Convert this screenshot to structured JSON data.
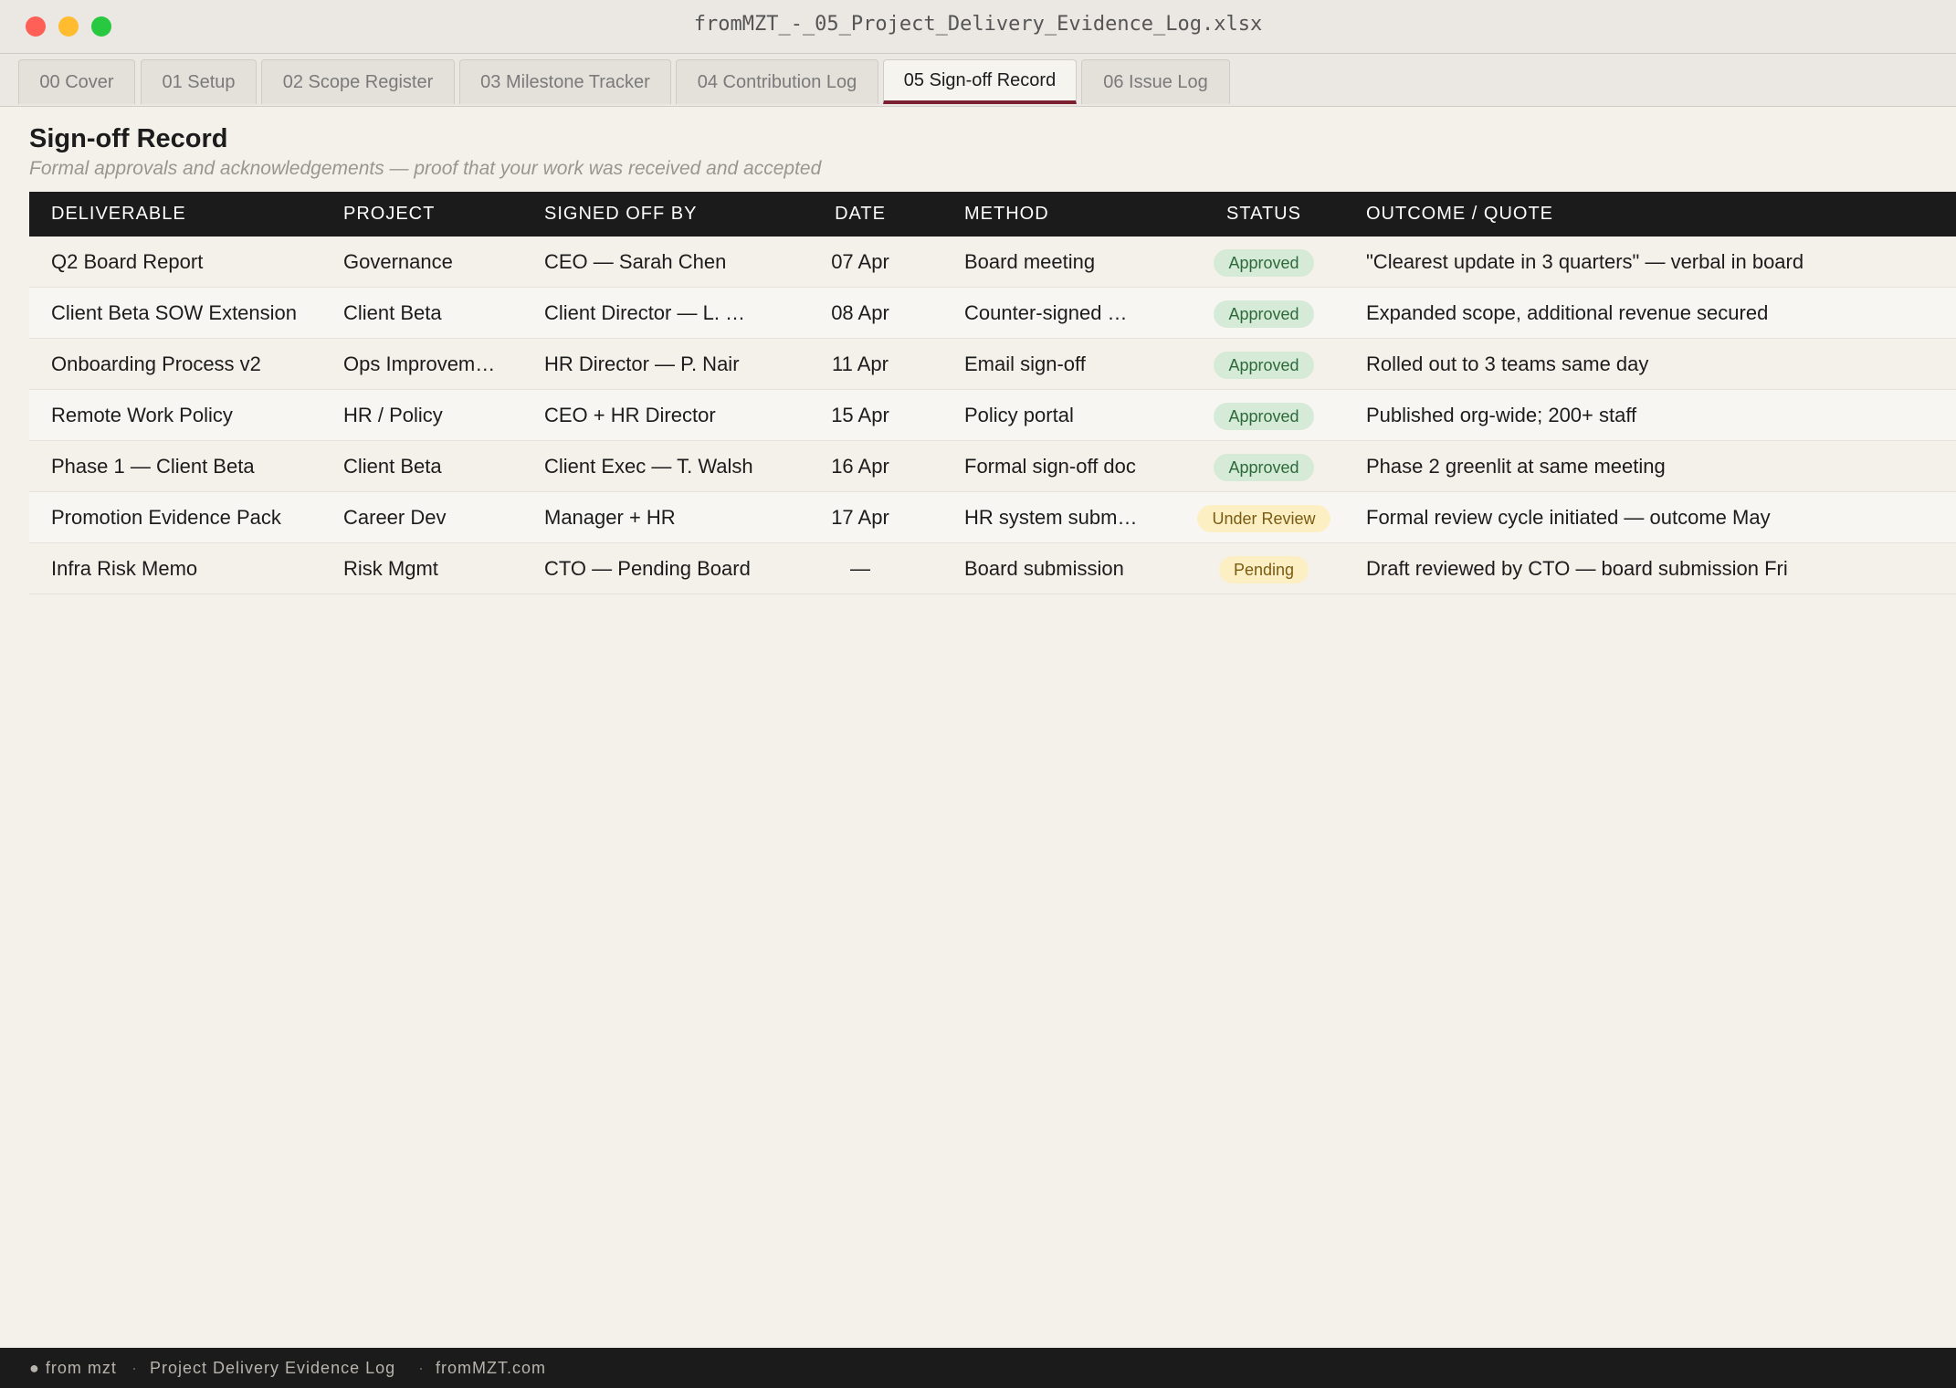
{
  "window": {
    "title": "fromMZT_-_05_Project_Delivery_Evidence_Log.xlsx"
  },
  "tabs": [
    {
      "label": "00 Cover",
      "active": false
    },
    {
      "label": "01 Setup",
      "active": false
    },
    {
      "label": "02 Scope Register",
      "active": false
    },
    {
      "label": "03 Milestone Tracker",
      "active": false
    },
    {
      "label": "04 Contribution Log",
      "active": false
    },
    {
      "label": "05 Sign-off Record",
      "active": true
    },
    {
      "label": "06 Issue Log",
      "active": false
    }
  ],
  "sheet": {
    "title": "Sign-off Record",
    "subtitle": "Formal approvals and acknowledgements — proof that your work was received and accepted"
  },
  "table": {
    "columns": [
      "DELIVERABLE",
      "PROJECT",
      "SIGNED OFF BY",
      "DATE",
      "METHOD",
      "STATUS",
      "OUTCOME / QUOTE"
    ],
    "rows": [
      {
        "deliverable": "Q2 Board Report",
        "project": "Governance",
        "signed_off_by": "CEO — Sarah Chen",
        "date": "07 Apr",
        "method": "Board meeting",
        "status": "Approved",
        "outcome": "\"Clearest update in 3 quarters\" — verbal in board"
      },
      {
        "deliverable": "Client Beta SOW Extension",
        "project": "Client Beta",
        "signed_off_by": "Client Director — L. …",
        "date": "08 Apr",
        "method": "Counter-signed …",
        "status": "Approved",
        "outcome": "Expanded scope, additional revenue secured"
      },
      {
        "deliverable": "Onboarding Process v2",
        "project": "Ops Improvem…",
        "signed_off_by": "HR Director — P. Nair",
        "date": "11 Apr",
        "method": "Email sign-off",
        "status": "Approved",
        "outcome": "Rolled out to 3 teams same day"
      },
      {
        "deliverable": "Remote Work Policy",
        "project": "HR / Policy",
        "signed_off_by": "CEO + HR Director",
        "date": "15 Apr",
        "method": "Policy portal",
        "status": "Approved",
        "outcome": "Published org-wide; 200+ staff"
      },
      {
        "deliverable": "Phase 1 — Client Beta",
        "project": "Client Beta",
        "signed_off_by": "Client Exec — T. Walsh",
        "date": "16 Apr",
        "method": "Formal sign-off doc",
        "status": "Approved",
        "outcome": "Phase 2 greenlit at same meeting"
      },
      {
        "deliverable": "Promotion Evidence Pack",
        "project": "Career Dev",
        "signed_off_by": "Manager + HR",
        "date": "17 Apr",
        "method": "HR system subm…",
        "status": "Under Review",
        "outcome": "Formal review cycle initiated — outcome May"
      },
      {
        "deliverable": "Infra Risk Memo",
        "project": "Risk Mgmt",
        "signed_off_by": "CTO — Pending Board",
        "date": "—",
        "method": "Board submission",
        "status": "Pending",
        "outcome": "Draft reviewed by CTO — board submission Fri"
      }
    ]
  },
  "footer": {
    "brand": "● from mzt",
    "separator": "·",
    "doc_name": "Project Delivery Evidence Log",
    "site": "fromMZT.com"
  },
  "colors": {
    "accent": "#7b2030",
    "header_bg": "#1b1b1b",
    "approved_bg": "#d5ead7",
    "pending_bg": "#fcefc4"
  }
}
